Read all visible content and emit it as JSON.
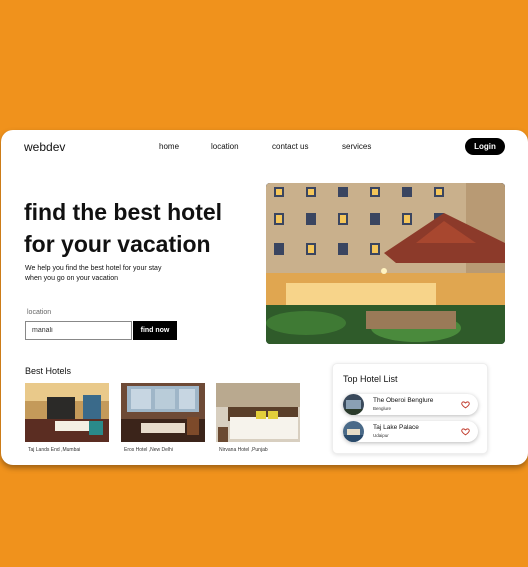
{
  "brand": "webdev",
  "nav": {
    "home": "home",
    "location": "location",
    "contact": "contact us",
    "services": "services"
  },
  "login_label": "Login",
  "hero": {
    "title_line1": "find the best hotel",
    "title_line2": "for your vacation",
    "subtitle_line1": "We help you find the best hotel for your stay",
    "subtitle_line2": "when you go on your vacation"
  },
  "search": {
    "label": "location",
    "value": "manali",
    "button": "find now"
  },
  "best_hotels": {
    "title": "Best Hotels",
    "items": [
      {
        "caption": "Taj Lands End ,Mumbai"
      },
      {
        "caption": "Eros Hotel ,New Delhi"
      },
      {
        "caption": "Nirvana Hotel ,Punjab"
      }
    ]
  },
  "top_list": {
    "title": "Top Hotel List",
    "items": [
      {
        "name": "The Oberoi Benglure",
        "city": "Benglure"
      },
      {
        "name": "Taj Lake Palace",
        "city": "Udaipur"
      }
    ]
  },
  "colors": {
    "background": "#f0921c",
    "button": "#000000",
    "heart": "#c0392b"
  }
}
